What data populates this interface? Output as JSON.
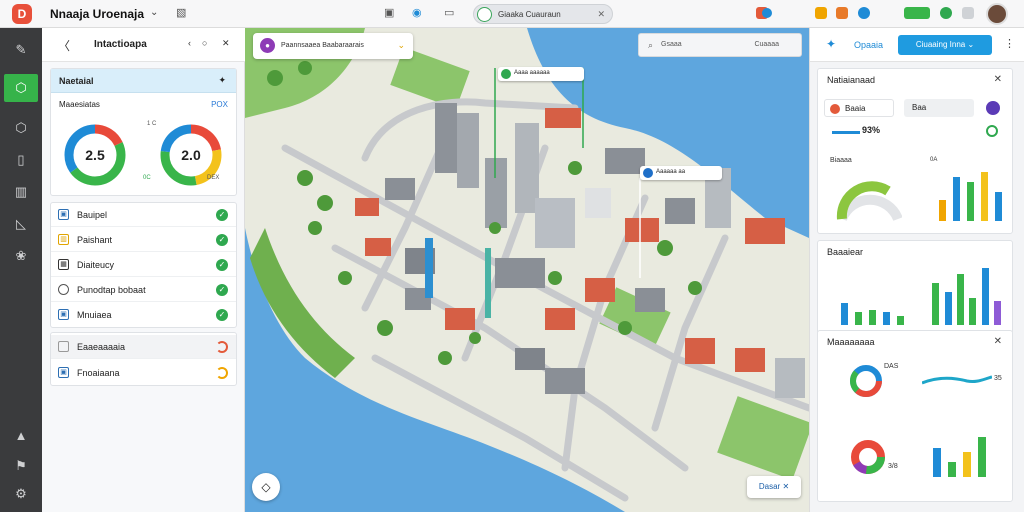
{
  "app": {
    "title": "Nnaaja Uroenaja",
    "tab_label": "Giaaka Cuauraun"
  },
  "left_panel": {
    "title": "Intactioapa",
    "stats": {
      "title": "Naetaial",
      "subtitle": "Maaesiatas",
      "subtitle_right": "POX",
      "donuts": [
        {
          "value": "2.5",
          "colors": [
            "#e84a3a",
            "#39b54a",
            "#1f8bd6"
          ],
          "share": [
            0.18,
            0.47,
            0.35
          ]
        },
        {
          "value": "2.0",
          "colors": [
            "#e84a3a",
            "#f3c21b",
            "#39b54a",
            "#1f8bd6"
          ],
          "share": [
            0.22,
            0.25,
            0.3,
            0.23
          ]
        }
      ],
      "donut_labels": [
        "1 C",
        "0C",
        "DEX"
      ]
    },
    "list": [
      {
        "label": "Bauipel"
      },
      {
        "label": "Paishant"
      },
      {
        "label": "Diaiteucy"
      },
      {
        "label": "Punodtap bobaat"
      },
      {
        "label": "Mnuiaea"
      }
    ],
    "list2": [
      {
        "label": "Eaaeaaaaia"
      },
      {
        "label": "Fnoaiaana"
      }
    ]
  },
  "map": {
    "search_text": "Paannsaaea  Baabaraarais",
    "search_right_text": "Cuaaaa",
    "search_left_text": "Gsaaa",
    "callouts": [
      "Aaaa aaaaaa",
      "Aaaaaa aa"
    ],
    "bottom_button": "Dasar"
  },
  "right_panel": {
    "header_title": "Opaaia",
    "header_button": "Ciuaaing Inna",
    "card1": {
      "title": "Natiaianaad",
      "chip_label": "Baaia",
      "chip2_label": "Baa",
      "metric": "93%",
      "sub_left": "Biaaaa",
      "sub_right": "0A",
      "bars": [
        0.4,
        0.85,
        0.75,
        0.95,
        0.55
      ],
      "bar_colors": [
        "#f0a500",
        "#1f8bd6",
        "#39b54a",
        "#f3c21b",
        "#1f8bd6"
      ]
    },
    "card2": {
      "title": "Baaaiear",
      "left_bars": [
        0.5,
        0.3,
        0.35,
        0.3,
        0.2
      ],
      "left_colors": [
        "#1f8bd6",
        "#39b54a",
        "#39b54a",
        "#1f8bd6",
        "#39b54a"
      ],
      "right_bars": [
        0.7,
        0.55,
        0.85,
        0.45,
        0.95,
        0.4
      ],
      "right_colors": [
        "#39b54a",
        "#1f8bd6",
        "#39b54a",
        "#39b54a",
        "#1f8bd6",
        "#8e5bd6"
      ]
    },
    "card3": {
      "title": "Maaaaaaaa",
      "ring_label": "DAS",
      "ring2_label": "3/8",
      "right_label": "35",
      "bars": [
        0.7,
        0.35,
        0.6,
        0.95
      ],
      "bar_colors": [
        "#1f8bd6",
        "#39b54a",
        "#f3c21b",
        "#39b54a"
      ]
    }
  }
}
